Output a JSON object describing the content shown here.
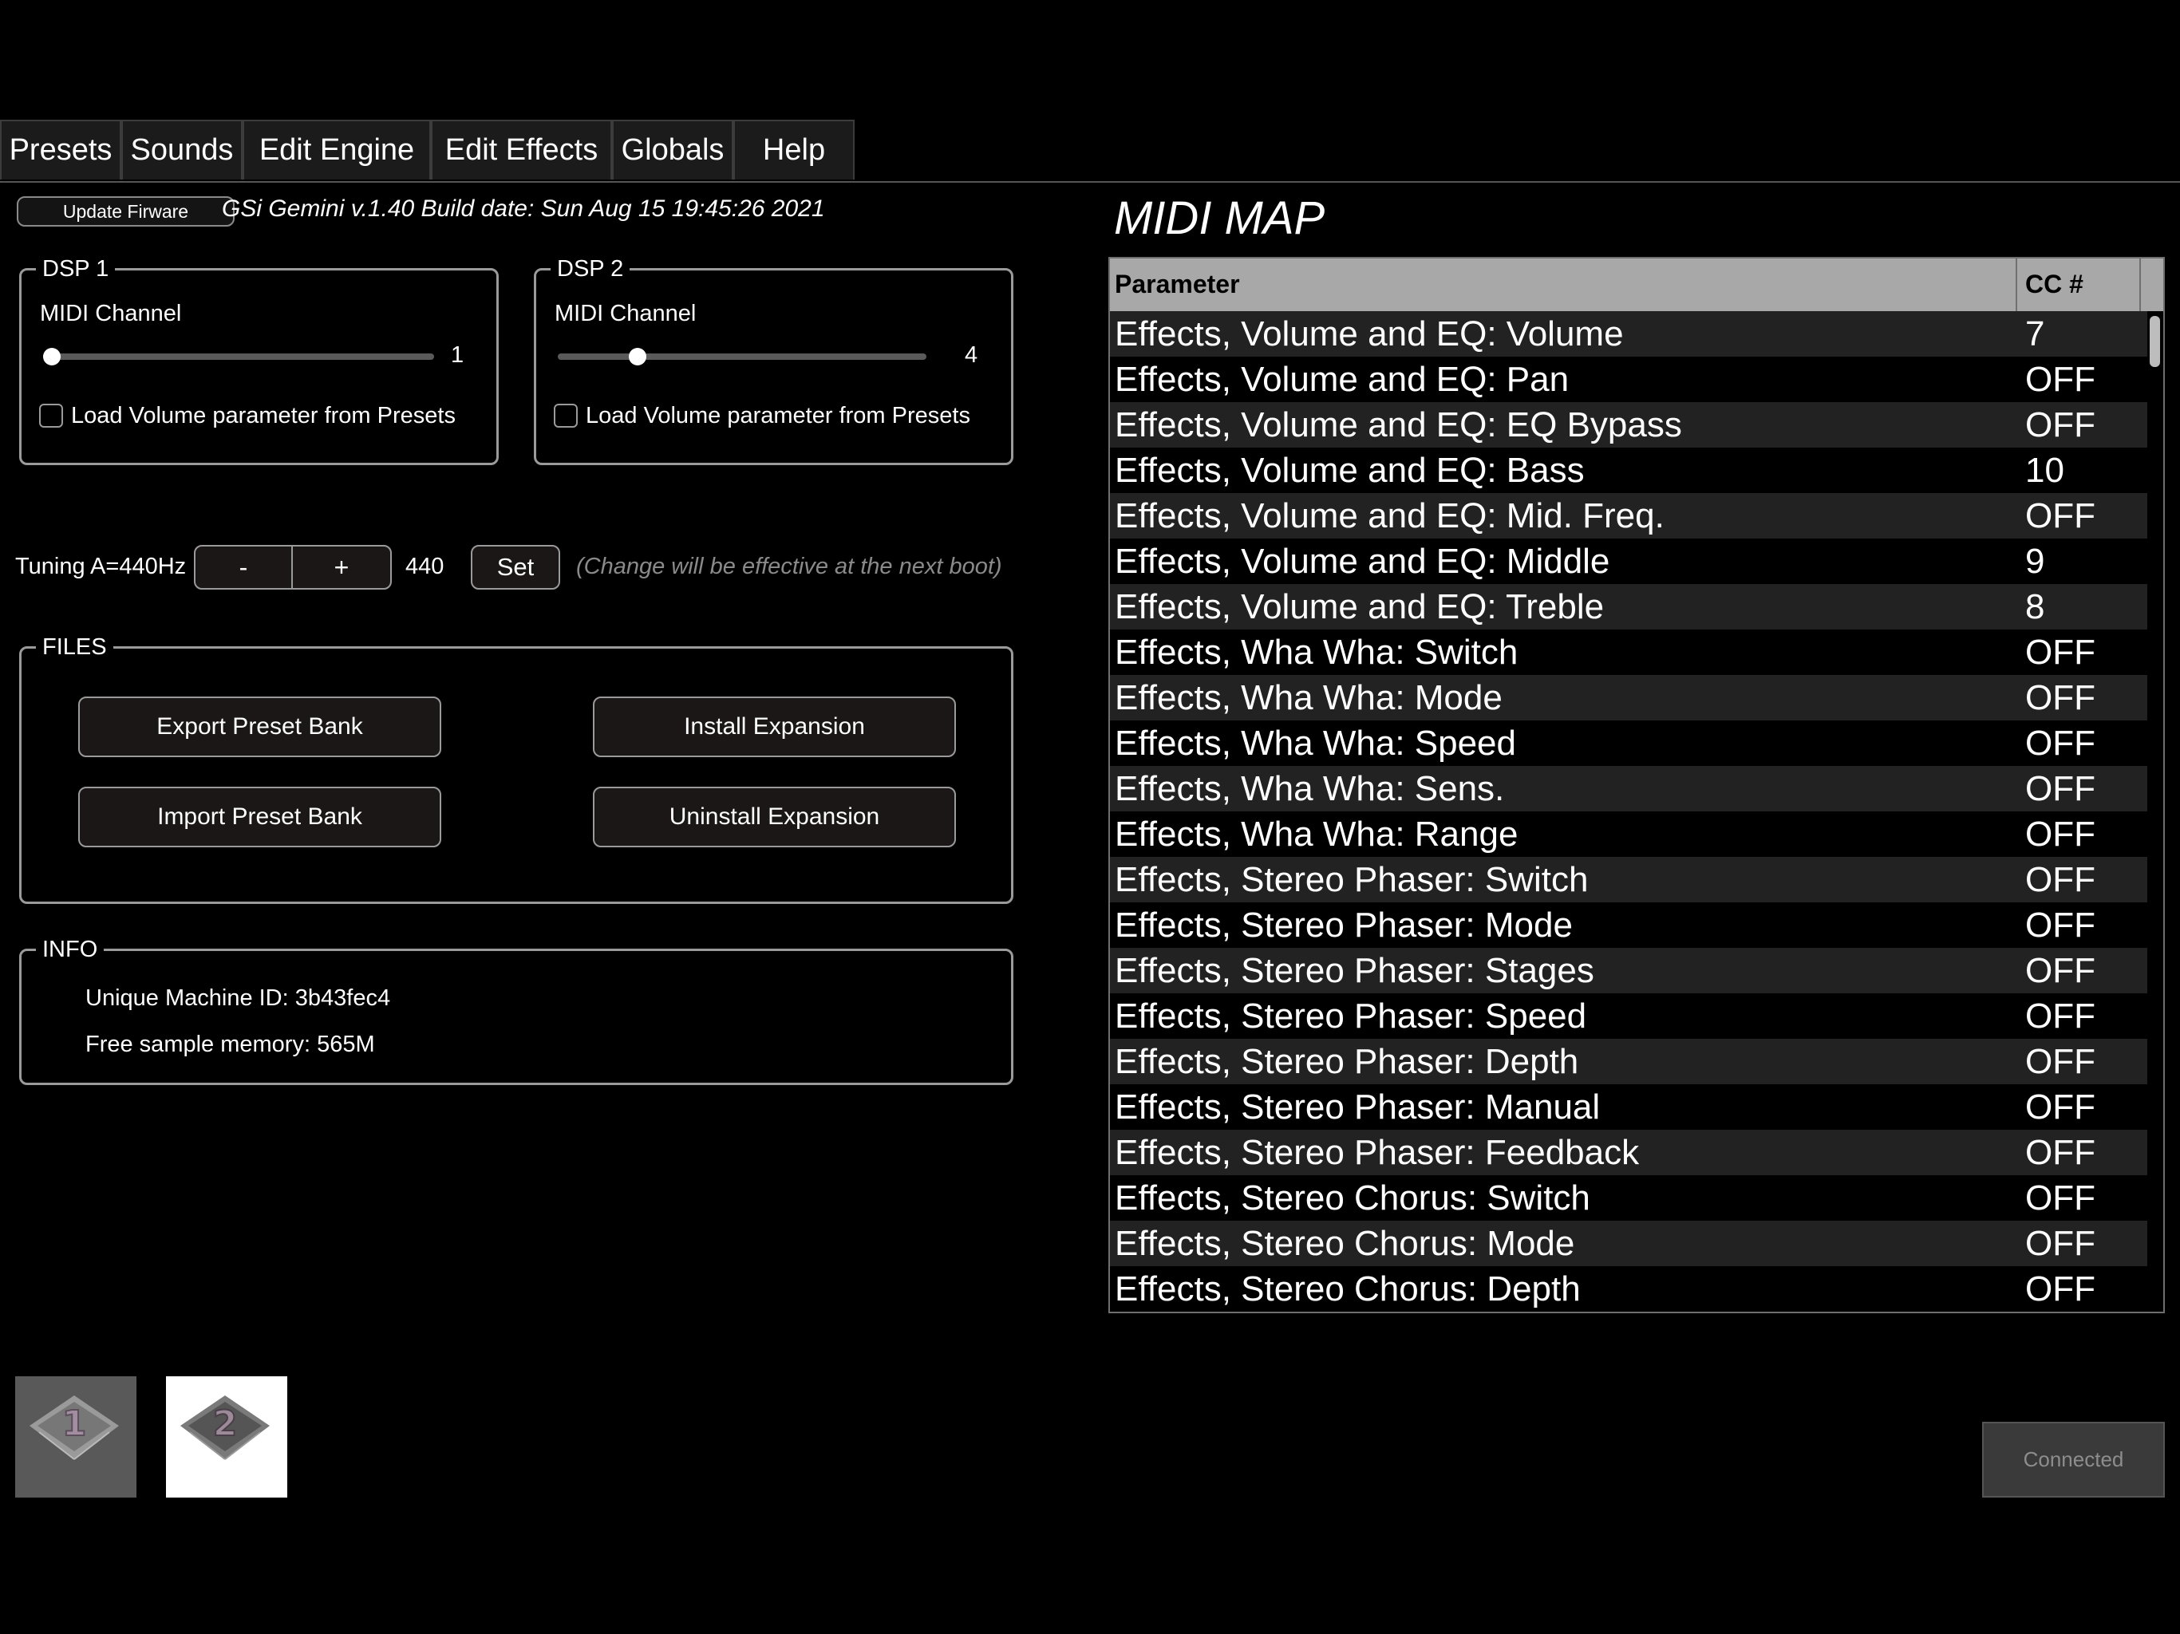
{
  "tabs": [
    "Presets",
    "Sounds",
    "Edit Engine",
    "Edit Effects",
    "Globals",
    "Help"
  ],
  "firmware": {
    "button_label": "Update Firware",
    "version_text": "GSi Gemini v.1.40 Build date: Sun Aug 15 19:45:26 2021"
  },
  "dsp1": {
    "title": "DSP 1",
    "midi_label": "MIDI Channel",
    "midi_value": "1",
    "checkbox_label": "Load Volume parameter from Presets",
    "checked": false
  },
  "dsp2": {
    "title": "DSP 2",
    "midi_label": "MIDI Channel",
    "midi_value": "4",
    "checkbox_label": "Load Volume parameter from Presets",
    "checked": false
  },
  "tuning": {
    "label": "Tuning A=440Hz",
    "minus_label": "-",
    "plus_label": "+",
    "value": "440",
    "set_label": "Set",
    "note": "(Change will be effective at the next boot)"
  },
  "files": {
    "title": "FILES",
    "export_label": "Export Preset Bank",
    "import_label": "Import Preset Bank",
    "install_label": "Install Expansion",
    "uninstall_label": "Uninstall Expansion"
  },
  "info": {
    "title": "INFO",
    "machine_id": "Unique Machine ID: 3b43fec4",
    "free_memory": "Free sample memory: 565M"
  },
  "midi_map": {
    "title": "MIDI MAP",
    "col_parameter": "Parameter",
    "col_cc": "CC #",
    "rows": [
      {
        "parameter": "Effects, Volume and EQ: Volume",
        "cc": "7"
      },
      {
        "parameter": "Effects, Volume and EQ: Pan",
        "cc": "OFF"
      },
      {
        "parameter": "Effects, Volume and EQ: EQ Bypass",
        "cc": "OFF"
      },
      {
        "parameter": "Effects, Volume and EQ: Bass",
        "cc": "10"
      },
      {
        "parameter": "Effects, Volume and EQ: Mid. Freq.",
        "cc": "OFF"
      },
      {
        "parameter": "Effects, Volume and EQ: Middle",
        "cc": "9"
      },
      {
        "parameter": "Effects, Volume and EQ: Treble",
        "cc": "8"
      },
      {
        "parameter": "Effects, Wha Wha: Switch",
        "cc": "OFF"
      },
      {
        "parameter": "Effects, Wha Wha: Mode",
        "cc": "OFF"
      },
      {
        "parameter": "Effects, Wha Wha: Speed",
        "cc": "OFF"
      },
      {
        "parameter": "Effects, Wha Wha: Sens.",
        "cc": "OFF"
      },
      {
        "parameter": "Effects, Wha Wha: Range",
        "cc": "OFF"
      },
      {
        "parameter": "Effects, Stereo Phaser: Switch",
        "cc": "OFF"
      },
      {
        "parameter": "Effects, Stereo Phaser: Mode",
        "cc": "OFF"
      },
      {
        "parameter": "Effects, Stereo Phaser: Stages",
        "cc": "OFF"
      },
      {
        "parameter": "Effects, Stereo Phaser: Speed",
        "cc": "OFF"
      },
      {
        "parameter": "Effects, Stereo Phaser: Depth",
        "cc": "OFF"
      },
      {
        "parameter": "Effects, Stereo Phaser: Manual",
        "cc": "OFF"
      },
      {
        "parameter": "Effects, Stereo Phaser: Feedback",
        "cc": "OFF"
      },
      {
        "parameter": "Effects, Stereo Chorus: Switch",
        "cc": "OFF"
      },
      {
        "parameter": "Effects, Stereo Chorus: Mode",
        "cc": "OFF"
      },
      {
        "parameter": "Effects, Stereo Chorus: Depth",
        "cc": "OFF"
      }
    ]
  },
  "dsp_icons": [
    {
      "label": "1",
      "icon": "chip-icon",
      "selected": false
    },
    {
      "label": "2",
      "icon": "chip-icon",
      "selected": true
    }
  ],
  "status": {
    "connected_label": "Connected"
  }
}
